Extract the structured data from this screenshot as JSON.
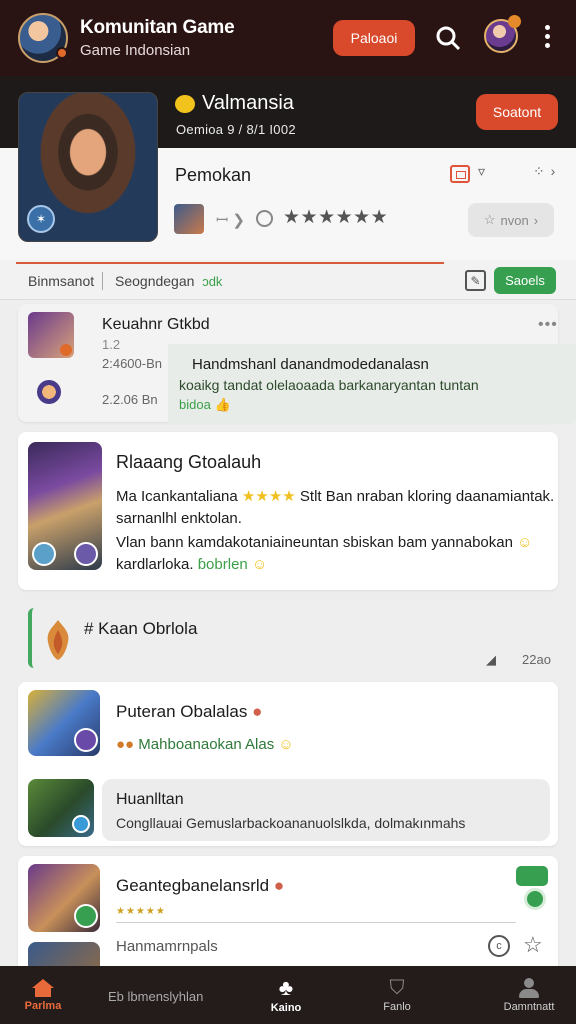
{
  "app_bar": {
    "title": "Komunitan Game",
    "subtitle": "Game Indonsian",
    "action_label": "Paloaoi"
  },
  "hero": {
    "name": "Valmansia",
    "meta": "Oemioa 9 / 8/1 I002",
    "action_label": "Soatont"
  },
  "profile": {
    "label": "Pemokan",
    "rating_icons": "★★★★★★",
    "button_label": "nvon"
  },
  "tabs": {
    "tab1": "Binmsanot",
    "tab2": "Seogndegan",
    "tab2_tag": "ɔdk",
    "save_label": "Saoels"
  },
  "post1": {
    "title": "Keuahnr Gtkbd",
    "count": "1.2",
    "time1": "2:4600-Bn",
    "time2": "2.2.06 Bn",
    "line1": "Handmshanl danandmodedanalasn",
    "line2": "koaikg tandat olelaoaada barkanaryantan tuntan",
    "line3": "bidoa"
  },
  "post2": {
    "title": "Rlaaang Gtoalauh",
    "line1_a": "Ma Icankantaliana",
    "line1_stars": "★★★★",
    "line1_b": "Stlt Ban nraban kloring daanamiantak.",
    "line2": "sarnanlhl enktolan.",
    "line3": "Vlan bann kamdakotaniaineuntan sbiskan bam yannabokan",
    "line4_a": "kardlarloka.",
    "line4_b": "ɓobrlen"
  },
  "section": {
    "title": "# Kaan Obrlola",
    "time": "22ao"
  },
  "post3": {
    "title": "Puteran Obalalas",
    "subtitle": "Mahboanaokan Alas",
    "inner_title": "Huanlltan",
    "inner_text": "Congllauai Gemuslarbackoananuolslkda, dolmakınmahs"
  },
  "post4": {
    "title": "Geantegbanelansrld",
    "rating_icons": "★★★★★",
    "last_text": "Hanmamrnpals"
  },
  "bottom_nav": {
    "home": "Parlma",
    "middle_text": "Eb lbmenslyhlan",
    "club": "Kaino",
    "community": "Fanlo",
    "profile": "Damntnatt"
  },
  "colors": {
    "accent_red": "#d94a2c",
    "accent_green": "#36a050",
    "bar_dark": "#2a1313"
  }
}
